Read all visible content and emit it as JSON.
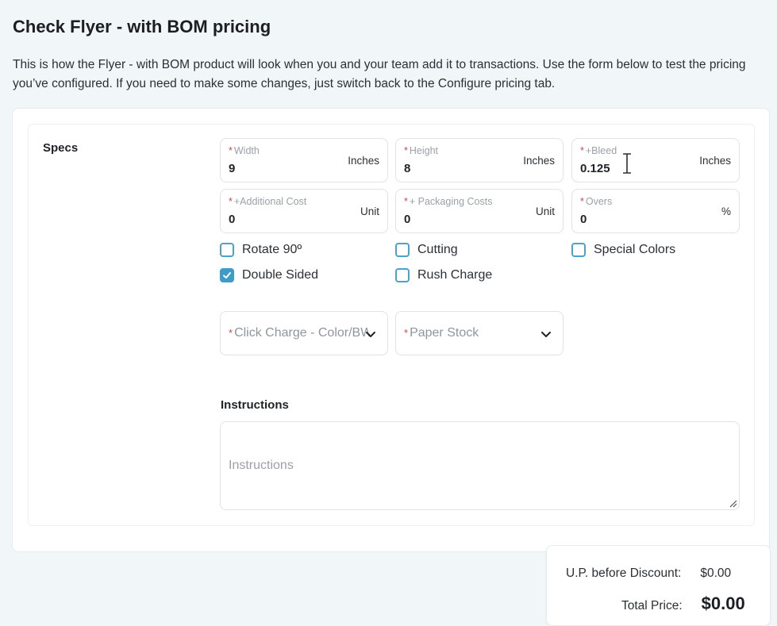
{
  "header": {
    "title": "Check Flyer - with BOM pricing",
    "description": "This is how the Flyer - with BOM product will look when you and your team add it to transactions. Use the form below to test the pricing you’ve configured. If you need to make some changes, just switch back to the Configure pricing tab."
  },
  "specs": {
    "section_label": "Specs",
    "required_mark": "*",
    "fields": [
      {
        "label": "Width",
        "value": "9",
        "unit": "Inches"
      },
      {
        "label": "Height",
        "value": "8",
        "unit": "Inches"
      },
      {
        "label": "+Bleed",
        "value": "0.125",
        "unit": "Inches"
      },
      {
        "label": "+Additional Cost",
        "value": "0",
        "unit": "Unit"
      },
      {
        "label": "+ Packaging Costs",
        "value": "0",
        "unit": "Unit"
      },
      {
        "label": "Overs",
        "value": "0",
        "unit": "%"
      }
    ],
    "checkboxes": [
      {
        "label": "Rotate 90º",
        "checked": false
      },
      {
        "label": "Cutting",
        "checked": false
      },
      {
        "label": "Special Colors",
        "checked": false
      },
      {
        "label": "Double Sided",
        "checked": true
      },
      {
        "label": "Rush Charge",
        "checked": false
      }
    ],
    "selects": [
      {
        "placeholder": "Click Charge - Color/BW"
      },
      {
        "placeholder": "Paper Stock"
      }
    ]
  },
  "instructions": {
    "title": "Instructions",
    "placeholder": "Instructions",
    "value": ""
  },
  "pricing": {
    "up_before_discount_label": "U.P. before Discount:",
    "up_before_discount_value": "$0.00",
    "total_label": "Total Price:",
    "total_value": "$0.00"
  },
  "colors": {
    "accent": "#3d9cc8",
    "required": "#d04a4a",
    "background": "#f1f6f8"
  }
}
